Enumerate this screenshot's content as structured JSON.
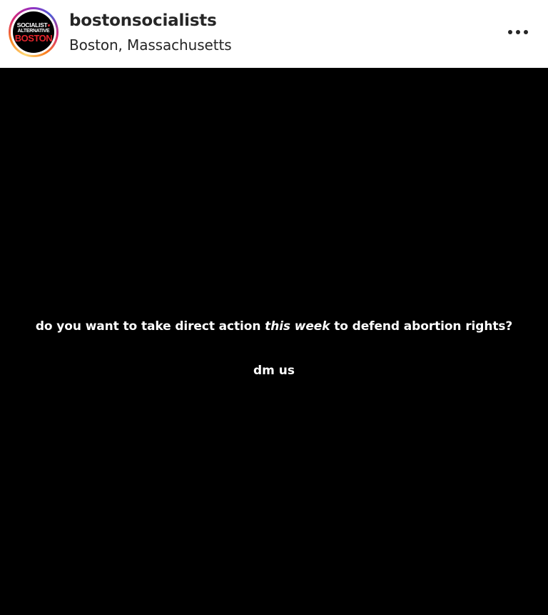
{
  "header": {
    "username": "bostonsocialists",
    "location": "Boston, Massachusetts",
    "more_icon": "more-horizontal-icon",
    "avatar": {
      "line1": "SOCIALIST",
      "line2": "ALTERNATIVE",
      "line3": "BOSTON",
      "accent_color": "#e8262d"
    }
  },
  "post": {
    "background_color": "#000000",
    "text_color": "#ffffff",
    "line1_before": "do you want to take direct action ",
    "line1_emphasis": "this week",
    "line1_after": " to defend abortion rights?",
    "line2": "dm us"
  }
}
